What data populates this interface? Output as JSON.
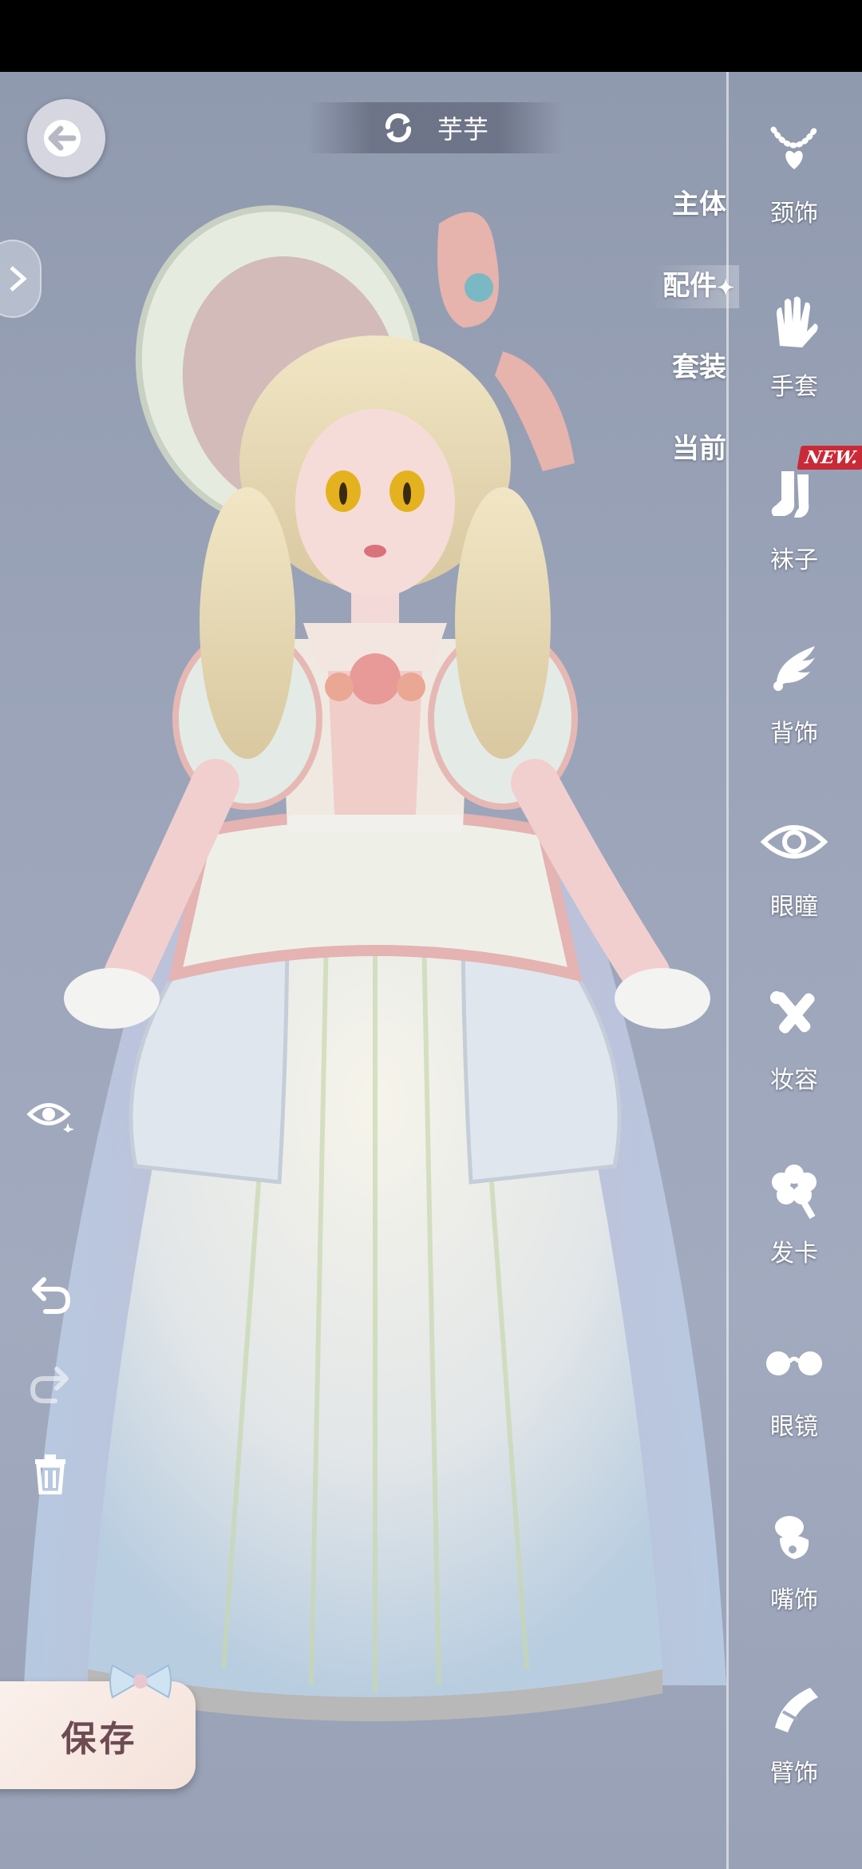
{
  "header": {
    "character_name": "芋芋"
  },
  "categories": [
    {
      "label": "主体",
      "active": false
    },
    {
      "label": "配件",
      "active": true
    },
    {
      "label": "套装",
      "active": false
    },
    {
      "label": "当前",
      "active": false
    }
  ],
  "accessory_slots": [
    {
      "label": "颈饰",
      "icon": "necklace-icon"
    },
    {
      "label": "手套",
      "icon": "glove-icon"
    },
    {
      "label": "袜子",
      "icon": "socks-icon",
      "badge": "NEW."
    },
    {
      "label": "背饰",
      "icon": "wing-icon"
    },
    {
      "label": "眼瞳",
      "icon": "eye-icon"
    },
    {
      "label": "妆容",
      "icon": "makeup-brush-icon"
    },
    {
      "label": "发卡",
      "icon": "hairpin-flower-icon"
    },
    {
      "label": "眼镜",
      "icon": "glasses-icon"
    },
    {
      "label": "嘴饰",
      "icon": "mouth-accessory-icon"
    },
    {
      "label": "臂饰",
      "icon": "arm-accessory-icon"
    }
  ],
  "actions": {
    "save_label": "保存"
  },
  "colors": {
    "accent_pink": "#e8b5b3",
    "badge_red": "#c92a37",
    "save_text": "#6e4a52"
  }
}
